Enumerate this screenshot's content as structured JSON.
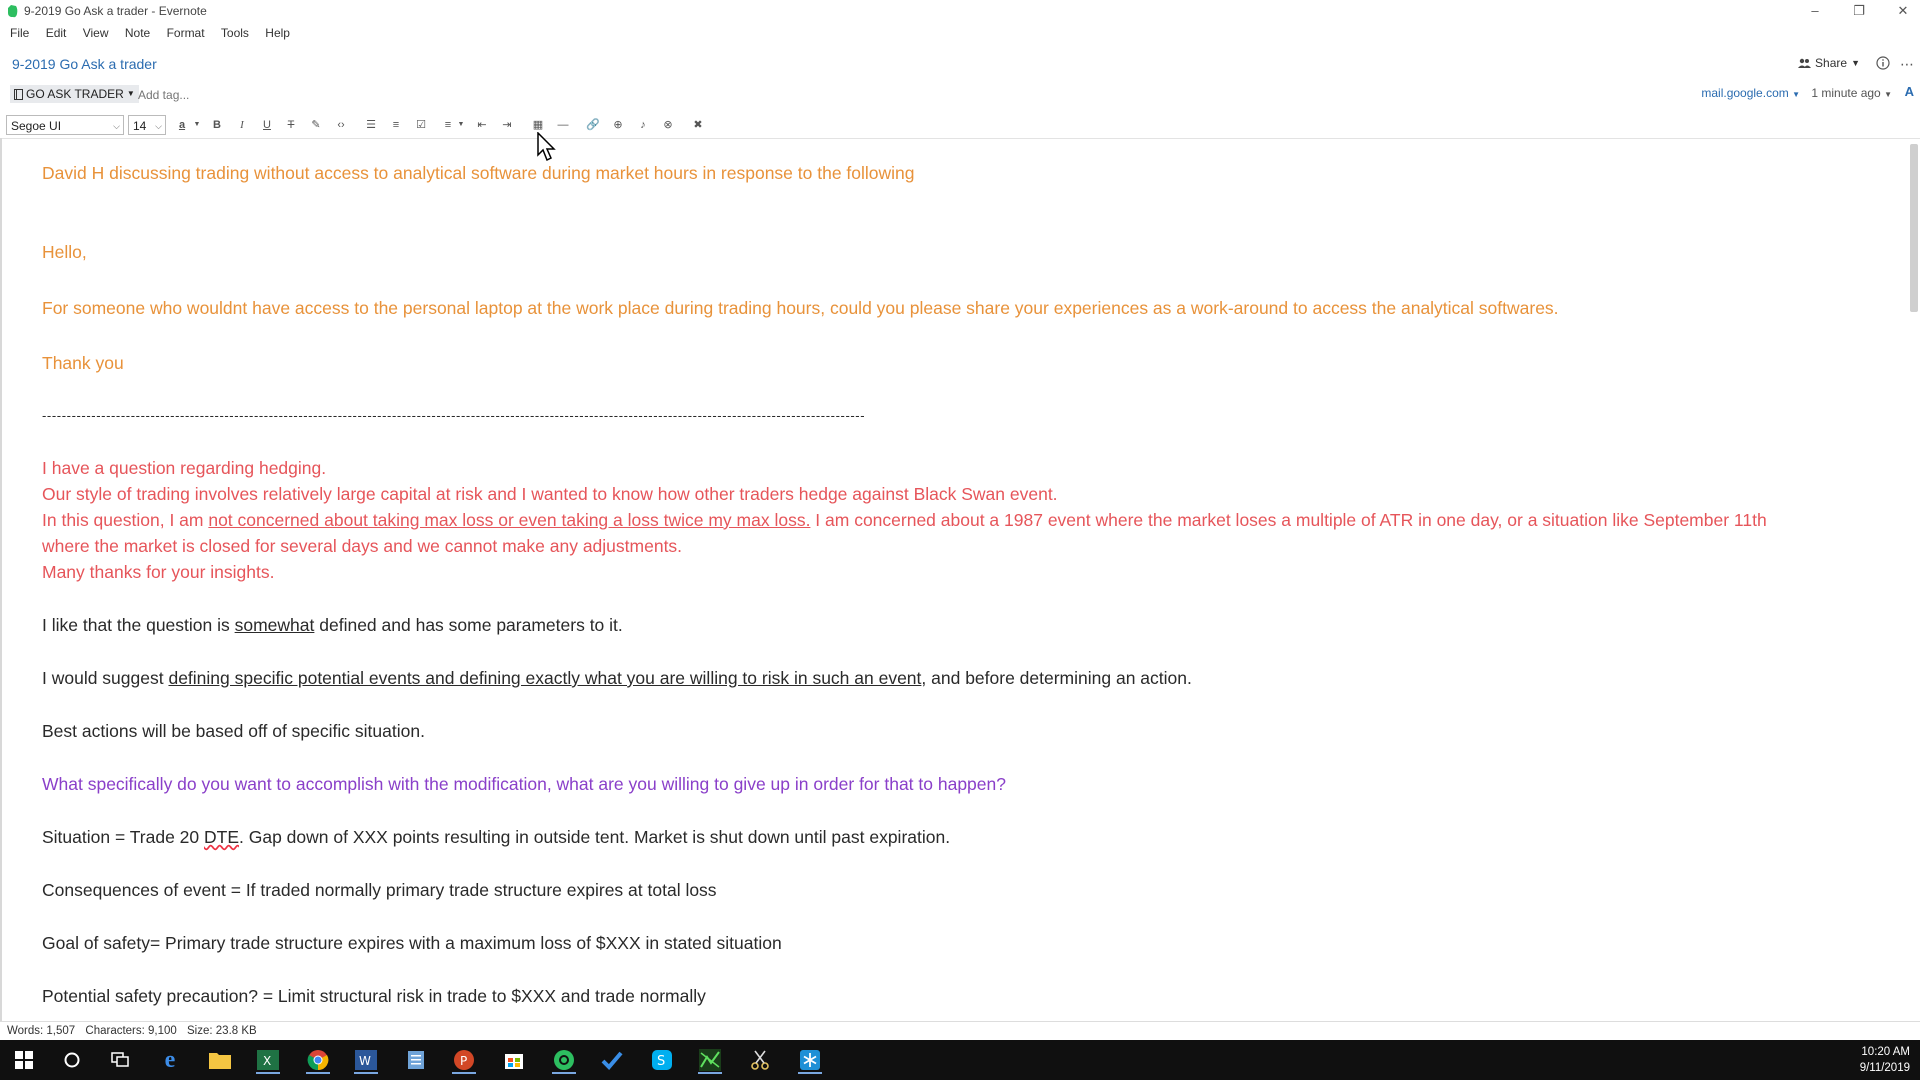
{
  "window": {
    "title": "9-2019 Go Ask a trader - Evernote",
    "minimize": "–",
    "restore": "❐",
    "close": "✕"
  },
  "menu": [
    "File",
    "Edit",
    "View",
    "Note",
    "Format",
    "Tools",
    "Help"
  ],
  "note": {
    "title": "9-2019 Go Ask a trader",
    "share_label": "Share",
    "notebook": "GO ASK TRADER",
    "tag_placeholder": "Add tag...",
    "source": "mail.google.com",
    "updated": "1 minute ago"
  },
  "toolbar": {
    "font": "Segoe UI",
    "size": "14"
  },
  "content": {
    "intro": "David H discussing  trading without access to analytical software during market hours in response to the following",
    "hello": "Hello,",
    "question1": "For someone who wouldnt have access to the personal laptop at the work place during trading hours, could you please share your experiences as a work-around to access the analytical softwares.",
    "thanks": "Thank you",
    "divider": "-----------------------------------------------------------------------------------------------------------------------------------------------------------------------",
    "q2_line1": "I have a question regarding hedging.",
    "q2_line2": "Our style of trading involves relatively large capital at risk and I wanted to know how other traders hedge against Black Swan event.",
    "q2_line3_a": "In this question, I am ",
    "q2_line3_u": "not concerned about taking max loss or even taking a loss twice my max loss.",
    "q2_line3_b": " I am concerned about a 1987 event where the market loses a multiple of ATR in one day, or a situation like September 11th",
    "q2_line4": "where the market is closed for several days and we cannot make any adjustments.",
    "q2_line5": "Many thanks for your insights.",
    "a1_a": "I like that the question is ",
    "a1_u": "somewhat",
    "a1_b": " defined and has some parameters to it.",
    "a2_a": "I would suggest ",
    "a2_u": "defining specific potential events and defining exactly what you are willing to risk in such an event",
    "a2_b": ", and before determining an action.",
    "a3": "Best actions will be based off of specific situation.",
    "a4": "What specifically do you want to accomplish with the modification, what are you willing to give up in order for that to happen?",
    "a5_a": "Situation = Trade 20 ",
    "a5_sq": "DTE",
    "a5_b": ". Gap down of XXX points resulting in outside tent. Market is shut down until past expiration.",
    "a6": "Consequences of event = If traded normally primary trade structure expires at total loss",
    "a7": "Goal of safety= Primary trade structure expires with a maximum loss of $XXX in stated situation",
    "a8": "Potential safety precaution? = Limit structural risk in trade to $XXX and trade normally"
  },
  "status": {
    "words": "Words: 1,507",
    "chars": "Characters: 9,100",
    "size": "Size: 23.8 KB"
  },
  "clock": {
    "time": "10:20 AM",
    "date": "9/11/2019"
  },
  "colors": {
    "orange": "#e8923a",
    "red": "#e6555a",
    "purple": "#8a3fc9",
    "link": "#2b6cb0"
  }
}
